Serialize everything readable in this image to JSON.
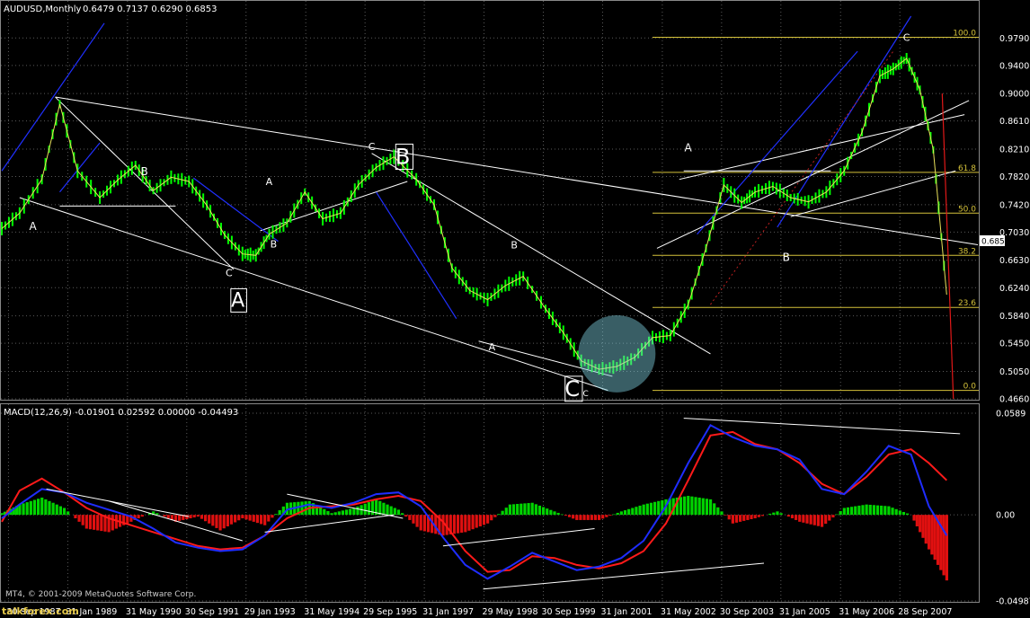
{
  "window": {
    "symbol_header": "AUDUSD,Monthly",
    "ohlc_header": "0.6479 0.7137 0.6290 0.6853",
    "copyright": "MT4, © 2001-2009 MetaQuotes Software Corp.",
    "watermark": "talkforex.com"
  },
  "colors": {
    "background": "#000000",
    "grid": "#5a5a5a",
    "price_line": "#ffffff",
    "candle": "#00ff00",
    "fib": "#d4c13a",
    "macd_line": "#1f2dff",
    "signal_line": "#ff1a1a",
    "hist_pos": "#00d400",
    "hist_neg": "#e01010",
    "trend": "#ffffff",
    "channel": "#2030ff"
  },
  "chart_data": [
    {
      "type": "line",
      "title": "AUDUSD,Monthly",
      "current_price": "0.6853",
      "ylim": [
        0.466,
        1.01
      ],
      "y_ticks": [
        "0.9790",
        "0.9400",
        "0.9000",
        "0.8610",
        "0.8210",
        "0.7820",
        "0.7420",
        "0.7030",
        "0.6630",
        "0.6240",
        "0.5840",
        "0.5450",
        "0.5050",
        "0.4660"
      ],
      "y_tick_values": [
        0.979,
        0.94,
        0.9,
        0.861,
        0.821,
        0.782,
        0.742,
        0.703,
        0.663,
        0.624,
        0.584,
        0.545,
        0.505,
        0.466
      ],
      "x_ticks": [
        "30 Sep 1987",
        "31 Jan 1989",
        "31 May 1990",
        "30 Sep 1991",
        "29 Jan 1993",
        "31 May 1994",
        "29 Sep 1995",
        "31 Jan 1997",
        "29 May 1998",
        "30 Sep 1999",
        "31 Jan 2001",
        "31 May 2002",
        "30 Sep 2003",
        "31 Jan 2005",
        "31 May 2006",
        "28 Sep 2007"
      ],
      "x_tick_years": [
        1987.75,
        1989.08,
        1990.42,
        1991.75,
        1993.08,
        1994.42,
        1995.75,
        1997.08,
        1998.42,
        1999.75,
        2001.08,
        2002.42,
        2003.75,
        2005.08,
        2006.42,
        2007.75
      ],
      "xlim": [
        1987.6,
        2009.5
      ],
      "series": [
        {
          "x": [
            1987.6,
            1988.0,
            1988.5,
            1988.9,
            1989.3,
            1989.8,
            1990.2,
            1990.6,
            1991.0,
            1991.4,
            1991.8,
            1992.2,
            1992.6,
            1993.0,
            1993.3,
            1993.6,
            1994.0,
            1994.4,
            1994.8,
            1995.2,
            1995.6,
            1996.0,
            1996.4,
            1996.9,
            1997.3,
            1997.7,
            1998.1,
            1998.5,
            1998.9,
            1999.3,
            1999.8,
            2000.2,
            2000.6,
            2001.0,
            2001.4,
            2001.8,
            2002.2,
            2002.6,
            2003.0,
            2003.4,
            2003.8,
            2004.2,
            2004.5,
            2004.9,
            2005.3,
            2005.7,
            2006.1,
            2006.5,
            2006.9,
            2007.3,
            2007.6,
            2007.9,
            2008.2,
            2008.5,
            2008.8
          ],
          "values": [
            0.708,
            0.73,
            0.778,
            0.885,
            0.79,
            0.752,
            0.777,
            0.798,
            0.762,
            0.781,
            0.775,
            0.741,
            0.699,
            0.672,
            0.67,
            0.7,
            0.716,
            0.76,
            0.722,
            0.73,
            0.77,
            0.795,
            0.81,
            0.778,
            0.742,
            0.652,
            0.62,
            0.607,
            0.627,
            0.64,
            0.594,
            0.56,
            0.52,
            0.508,
            0.512,
            0.525,
            0.553,
            0.556,
            0.6,
            0.68,
            0.77,
            0.745,
            0.76,
            0.768,
            0.752,
            0.746,
            0.76,
            0.79,
            0.845,
            0.925,
            0.935,
            0.95,
            0.905,
            0.82,
            0.614
          ]
        }
      ],
      "fib_levels": [
        {
          "label": "100.0",
          "value": 0.98
        },
        {
          "label": "61.8",
          "value": 0.788
        },
        {
          "label": "50.0",
          "value": 0.73
        },
        {
          "label": "38.2",
          "value": 0.67
        },
        {
          "label": "23.6",
          "value": 0.596
        },
        {
          "label": "0.0",
          "value": 0.478
        }
      ],
      "annotations": [
        "A",
        "B",
        "C",
        "A",
        "B",
        "C",
        "A",
        "B",
        "C",
        "A",
        "B",
        "C",
        "A",
        "B",
        "C"
      ]
    },
    {
      "type": "bar",
      "title": "MACD(12,26,9) -0.01901 0.02592 0.00000 -0.04493",
      "ylim": [
        -0.04987,
        0.0589
      ],
      "y_ticks": [
        "0.0589",
        "0.00",
        "-0.04987"
      ],
      "y_tick_values": [
        0.0589,
        0.0,
        -0.04987
      ],
      "series": [
        {
          "name": "MACD",
          "x": [
            1987.6,
            1988.0,
            1988.5,
            1989.0,
            1989.5,
            1990.0,
            1990.5,
            1991.0,
            1991.5,
            1992.0,
            1992.5,
            1993.0,
            1993.5,
            1994.0,
            1994.5,
            1995.0,
            1995.5,
            1996.0,
            1996.5,
            1997.0,
            1997.5,
            1998.0,
            1998.5,
            1999.0,
            1999.5,
            2000.0,
            2000.5,
            2001.0,
            2001.5,
            2002.0,
            2002.5,
            2003.0,
            2003.5,
            2004.0,
            2004.5,
            2005.0,
            2005.5,
            2006.0,
            2006.5,
            2007.0,
            2007.5,
            2008.0,
            2008.4,
            2008.8
          ],
          "values": [
            -0.002,
            0.006,
            0.015,
            0.013,
            0.007,
            0.003,
            -0.001,
            -0.008,
            -0.016,
            -0.019,
            -0.021,
            -0.02,
            -0.012,
            0.003,
            0.006,
            0.004,
            0.007,
            0.012,
            0.013,
            0.005,
            -0.013,
            -0.029,
            -0.037,
            -0.03,
            -0.022,
            -0.027,
            -0.032,
            -0.03,
            -0.025,
            -0.015,
            0.005,
            0.03,
            0.052,
            0.045,
            0.04,
            0.038,
            0.032,
            0.015,
            0.012,
            0.025,
            0.04,
            0.035,
            0.005,
            -0.012
          ]
        },
        {
          "name": "Signal",
          "x": [
            1987.6,
            1988.0,
            1988.5,
            1989.0,
            1989.5,
            1990.0,
            1990.5,
            1991.0,
            1991.5,
            1992.0,
            1992.5,
            1993.0,
            1993.5,
            1994.0,
            1994.5,
            1995.0,
            1995.5,
            1996.0,
            1996.5,
            1997.0,
            1997.5,
            1998.0,
            1998.5,
            1999.0,
            1999.5,
            2000.0,
            2000.5,
            2001.0,
            2001.5,
            2002.0,
            2002.5,
            2003.0,
            2003.5,
            2004.0,
            2004.5,
            2005.0,
            2005.5,
            2006.0,
            2006.5,
            2007.0,
            2007.5,
            2008.0,
            2008.4,
            2008.8
          ],
          "values": [
            -0.004,
            0.014,
            0.021,
            0.013,
            0.004,
            -0.002,
            -0.006,
            -0.01,
            -0.014,
            -0.018,
            -0.02,
            -0.019,
            -0.012,
            -0.002,
            0.004,
            0.005,
            0.006,
            0.009,
            0.011,
            0.008,
            -0.004,
            -0.021,
            -0.033,
            -0.032,
            -0.024,
            -0.025,
            -0.029,
            -0.031,
            -0.028,
            -0.021,
            -0.005,
            0.02,
            0.046,
            0.048,
            0.041,
            0.038,
            0.03,
            0.018,
            0.012,
            0.022,
            0.035,
            0.038,
            0.03,
            0.02
          ]
        },
        {
          "name": "Histogram",
          "x": [
            1987.6,
            1988.0,
            1988.5,
            1989.0,
            1989.5,
            1990.0,
            1990.5,
            1991.0,
            1991.5,
            1992.0,
            1992.5,
            1993.0,
            1993.5,
            1994.0,
            1994.5,
            1995.0,
            1995.5,
            1996.0,
            1996.5,
            1997.0,
            1997.5,
            1998.0,
            1998.5,
            1999.0,
            1999.5,
            2000.0,
            2000.5,
            2001.0,
            2001.5,
            2002.0,
            2002.5,
            2003.0,
            2003.5,
            2004.0,
            2004.5,
            2005.0,
            2005.5,
            2006.0,
            2006.5,
            2007.0,
            2007.5,
            2008.0,
            2008.4,
            2008.8
          ],
          "values": [
            0.001,
            0.006,
            0.01,
            0.004,
            -0.008,
            -0.01,
            -0.004,
            0.002,
            -0.004,
            -0.001,
            -0.009,
            -0.002,
            -0.006,
            0.007,
            0.008,
            0.001,
            0.004,
            0.009,
            0.003,
            -0.009,
            -0.012,
            -0.01,
            -0.005,
            0.006,
            0.007,
            0.002,
            -0.003,
            -0.003,
            0.002,
            0.006,
            0.009,
            0.011,
            0.009,
            -0.005,
            -0.002,
            0.002,
            -0.004,
            -0.007,
            0.004,
            0.006,
            0.005,
            0.0,
            -0.02,
            -0.038
          ]
        }
      ]
    }
  ]
}
